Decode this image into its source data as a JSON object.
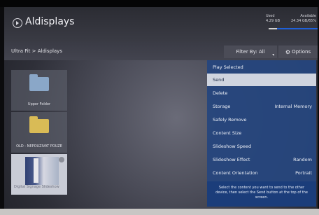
{
  "app": {
    "title": "Aldisplays"
  },
  "storage": {
    "used_label": "Used",
    "used_value": "4.29 GB",
    "available_label": "Available",
    "available_value": "24.34 GB/65%"
  },
  "breadcrumb": "Ultra Fit > Aldisplays",
  "toolbar": {
    "filter_label": "Filter By: All",
    "options_label": "Options"
  },
  "tiles": [
    {
      "label": "Upper Folder",
      "icon": "folder-blue-icon"
    },
    {
      "label": "OLD - NEPOUZIVAT POUZE",
      "icon": "folder-yellow-icon"
    },
    {
      "label": "Digital Signage Slideshow",
      "icon": "thumbnail"
    }
  ],
  "menu": {
    "items": [
      {
        "label": "Play Selected",
        "value": ""
      },
      {
        "label": "Send",
        "value": ""
      },
      {
        "label": "Delete",
        "value": ""
      },
      {
        "label": "Storage",
        "value": "Internal Memory"
      },
      {
        "label": "Safely Remove",
        "value": ""
      },
      {
        "label": "Content Size",
        "value": ""
      },
      {
        "label": "Slideshow Speed",
        "value": ""
      },
      {
        "label": "Slideshow Effect",
        "value": "Random"
      },
      {
        "label": "Content Orientation",
        "value": "Portrait"
      }
    ],
    "selected_index": 1,
    "help_text": "Select the content you want to send to the other device, then select the Send button at the top of the screen."
  },
  "colors": {
    "menu_bg": "#26467d",
    "selected_bg": "#cfd4df",
    "accent": "#1f60d8"
  }
}
